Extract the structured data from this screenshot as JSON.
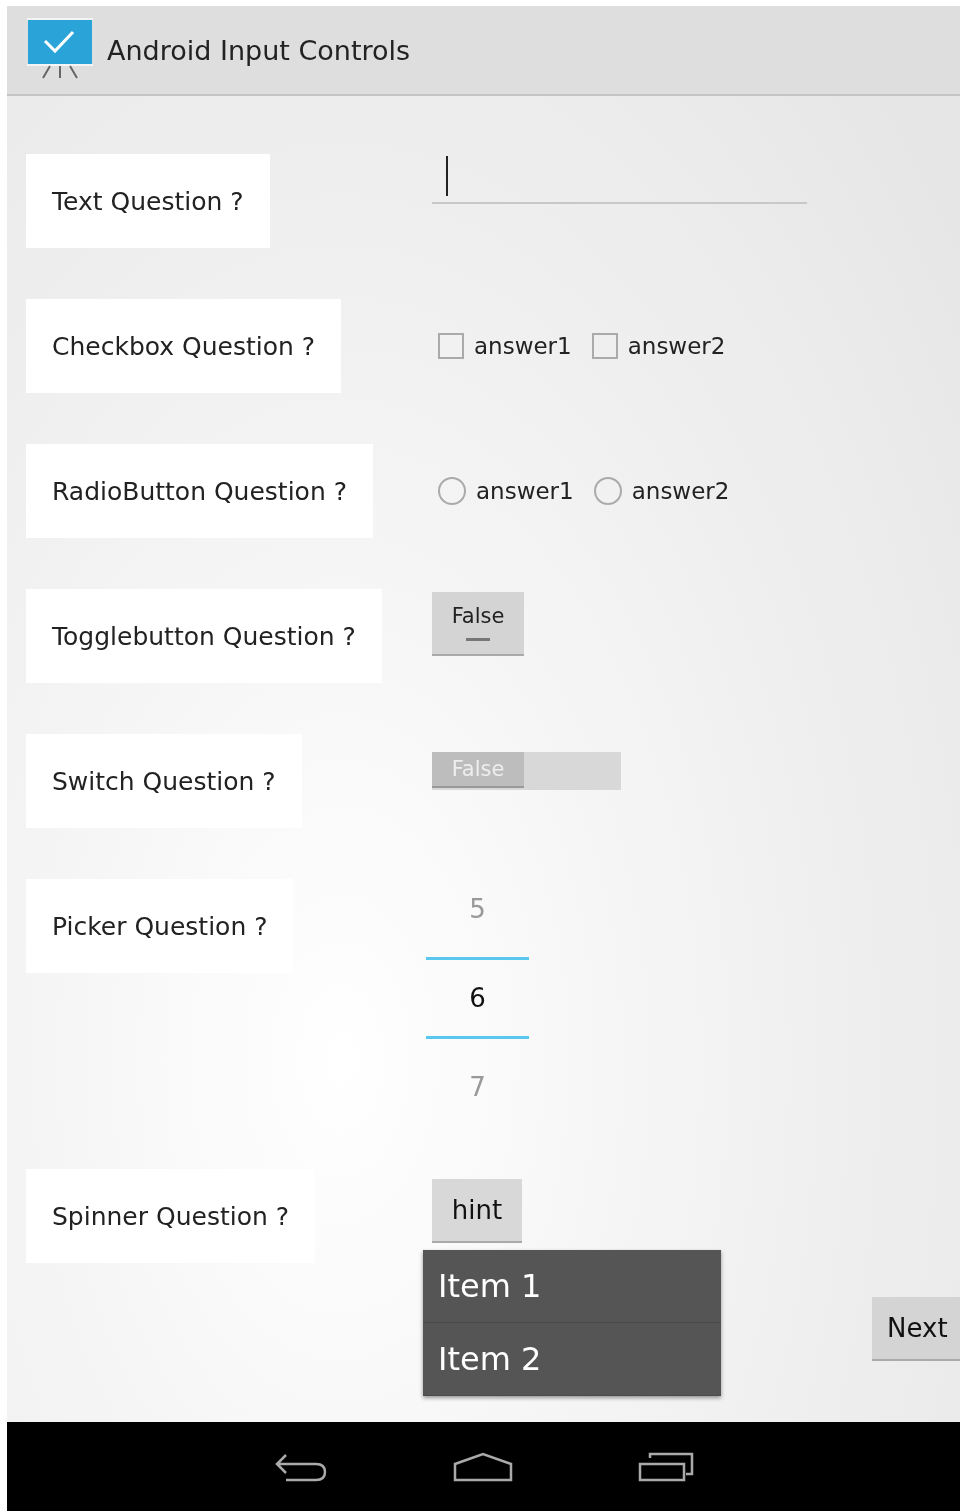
{
  "app_bar": {
    "title": "Android Input Controls"
  },
  "questions": [
    {
      "kind": "text",
      "label": "Text Question ?"
    },
    {
      "kind": "checkbox",
      "label": "Checkbox Question ?",
      "options": [
        {
          "label": "answer1",
          "checked": false
        },
        {
          "label": "answer2",
          "checked": false
        }
      ]
    },
    {
      "kind": "radio",
      "label": "RadioButton Question ?",
      "options": [
        {
          "label": "answer1",
          "selected": false
        },
        {
          "label": "answer2",
          "selected": false
        }
      ]
    },
    {
      "kind": "toggle",
      "label": "Togglebutton Question ?",
      "text": "False",
      "on": false
    },
    {
      "kind": "switch",
      "label": "Switch Question ?",
      "text": "False",
      "on": false
    },
    {
      "kind": "picker",
      "label": "Picker Question ?",
      "values": [
        {
          "label": "5",
          "selected": false
        },
        {
          "label": "6",
          "selected": true
        },
        {
          "label": "7",
          "selected": false
        }
      ]
    },
    {
      "kind": "spinner",
      "label": "Spinner Question ?",
      "hint": "hint",
      "expanded": true,
      "items": [
        "Item 1",
        "Item 2"
      ]
    }
  ],
  "next_button": "Next"
}
